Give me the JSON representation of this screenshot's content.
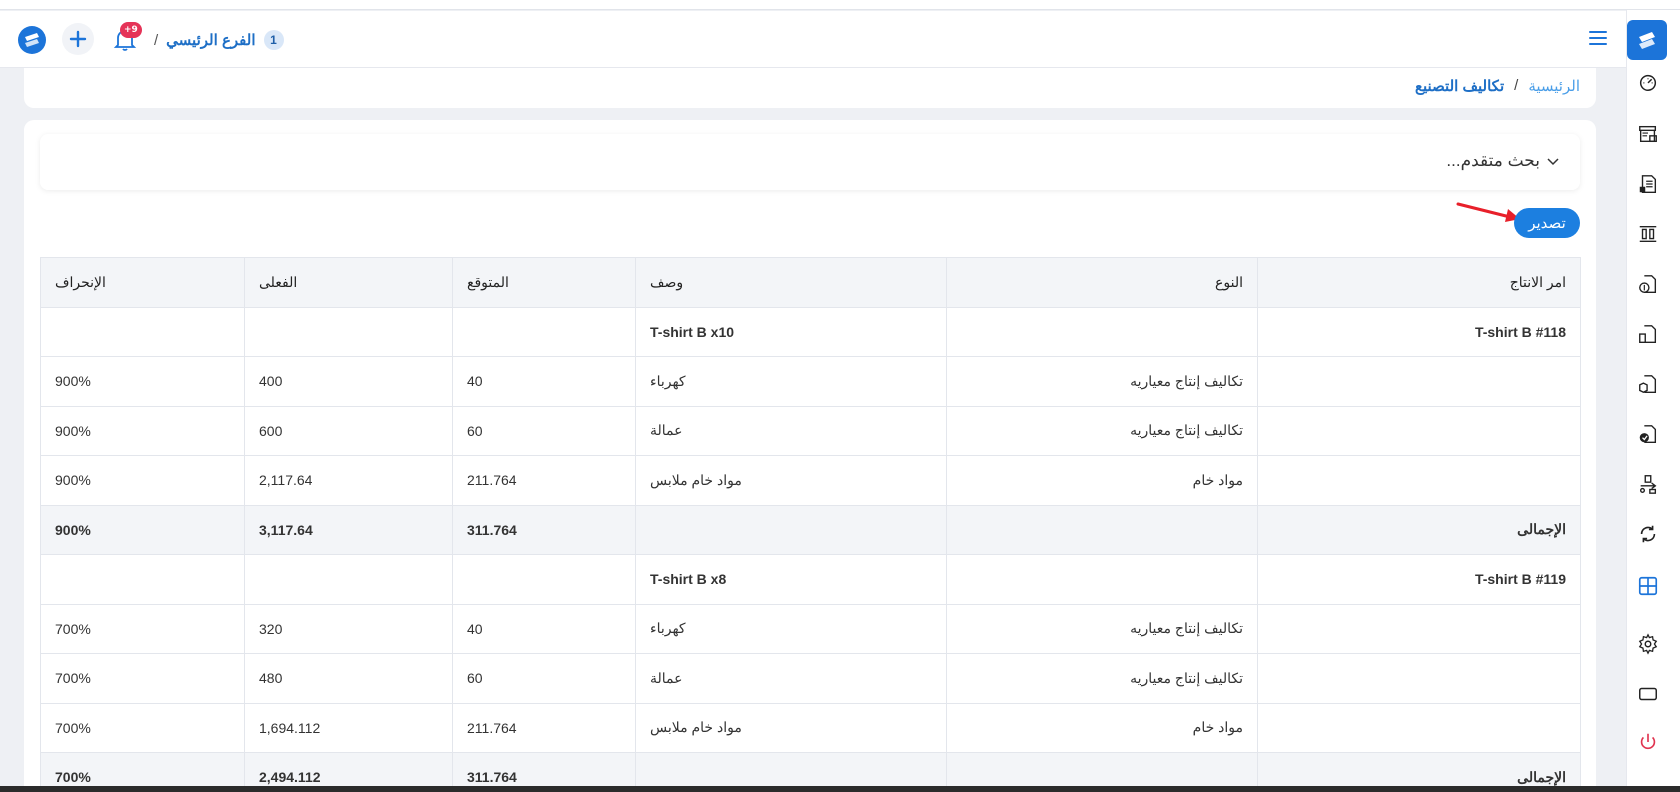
{
  "header": {
    "branch_count": "1",
    "branch_name": "الفرع الرئيسي",
    "branch_separator": "/",
    "notification_badge": "+9"
  },
  "breadcrumb": {
    "home": "الرئيسية",
    "separator": "/",
    "current": "تكاليف التصنيع"
  },
  "advanced_search": {
    "label": "بحث متقدم..."
  },
  "export_button": {
    "label": "تصدير"
  },
  "table": {
    "columns": [
      "امر الانتاج",
      "النوع",
      "وصف",
      "المتوقع",
      "الفعلى",
      "الإنحراف"
    ],
    "rows": [
      {
        "order": "T-shirt B #118",
        "type": "",
        "desc": "T-shirt B x10",
        "expected": "",
        "actual": "",
        "deviation": "",
        "kind": "header"
      },
      {
        "order": "",
        "type": "تكاليف إنتاج معياريه",
        "desc": "كهرباء",
        "expected": "40",
        "actual": "400",
        "deviation": "900%",
        "kind": "item"
      },
      {
        "order": "",
        "type": "تكاليف إنتاج معياريه",
        "desc": "عمالة",
        "expected": "60",
        "actual": "600",
        "deviation": "900%",
        "kind": "item"
      },
      {
        "order": "",
        "type": "مواد خام",
        "desc": "مواد خام ملابس",
        "expected": "211.764",
        "actual": "2,117.64",
        "deviation": "900%",
        "kind": "item"
      },
      {
        "order": "الإجمالى",
        "type": "",
        "desc": "",
        "expected": "311.764",
        "actual": "3,117.64",
        "deviation": "900%",
        "kind": "total"
      },
      {
        "order": "T-shirt B #119",
        "type": "",
        "desc": "T-shirt B x8",
        "expected": "",
        "actual": "",
        "deviation": "",
        "kind": "header"
      },
      {
        "order": "",
        "type": "تكاليف إنتاج معياريه",
        "desc": "كهرباء",
        "expected": "40",
        "actual": "320",
        "deviation": "700%",
        "kind": "item"
      },
      {
        "order": "",
        "type": "تكاليف إنتاج معياريه",
        "desc": "عمالة",
        "expected": "60",
        "actual": "480",
        "deviation": "700%",
        "kind": "item"
      },
      {
        "order": "",
        "type": "مواد خام",
        "desc": "مواد خام ملابس",
        "expected": "211.764",
        "actual": "1,694.112",
        "deviation": "700%",
        "kind": "item"
      },
      {
        "order": "الإجمالى",
        "type": "",
        "desc": "",
        "expected": "311.764",
        "actual": "2,494.112",
        "deviation": "700%",
        "kind": "total"
      }
    ]
  },
  "sidebar": {
    "icons": [
      "dashboard-icon",
      "store-icon",
      "invoice-icon",
      "columns-icon",
      "document-money-icon",
      "document-icon",
      "document-box-icon",
      "document-check-icon",
      "transfer-icon",
      "refresh-icon",
      "layout-icon",
      "gear-icon",
      "screen-icon",
      "power-icon"
    ]
  },
  "colors": {
    "accent": "#1c7fe0",
    "brand": "#1c74d9",
    "badge": "#e53357",
    "power": "#e0334f"
  }
}
